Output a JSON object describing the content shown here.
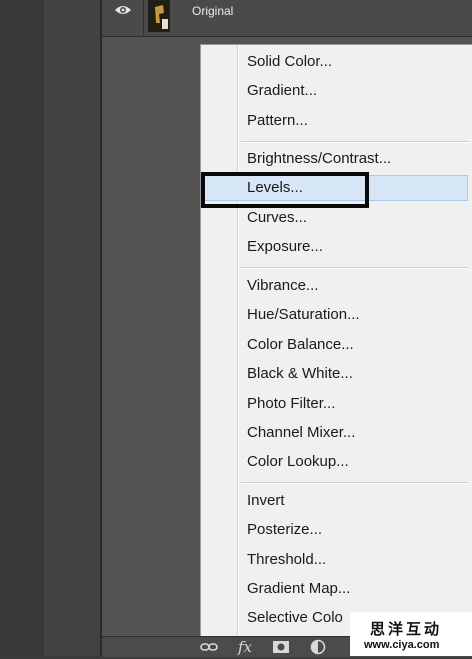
{
  "layer": {
    "name": "Original"
  },
  "menu": {
    "items": [
      {
        "label": "Solid Color...",
        "highlighted": false
      },
      {
        "label": "Gradient...",
        "highlighted": false
      },
      {
        "label": "Pattern...",
        "highlighted": false
      },
      {
        "label": "Brightness/Contrast...",
        "highlighted": false
      },
      {
        "label": "Levels...",
        "highlighted": true
      },
      {
        "label": "Curves...",
        "highlighted": false
      },
      {
        "label": "Exposure...",
        "highlighted": false
      },
      {
        "label": "Vibrance...",
        "highlighted": false
      },
      {
        "label": "Hue/Saturation...",
        "highlighted": false
      },
      {
        "label": "Color Balance...",
        "highlighted": false
      },
      {
        "label": "Black & White...",
        "highlighted": false
      },
      {
        "label": "Photo Filter...",
        "highlighted": false
      },
      {
        "label": "Channel Mixer...",
        "highlighted": false
      },
      {
        "label": "Color Lookup...",
        "highlighted": false
      },
      {
        "label": "Invert",
        "highlighted": false
      },
      {
        "label": "Posterize...",
        "highlighted": false
      },
      {
        "label": "Threshold...",
        "highlighted": false
      },
      {
        "label": "Gradient Map...",
        "highlighted": false
      },
      {
        "label": "Selective Colo",
        "highlighted": false
      }
    ]
  },
  "bottom_bar": {
    "icons": [
      "link-icon",
      "fx-icon",
      "mask-icon",
      "adjustment-layer-icon"
    ],
    "fx_label": "fx"
  },
  "watermark": {
    "chinese": "思洋互动",
    "url": "www.ciya.com"
  },
  "colors": {
    "menu_bg": "#f0f0f0",
    "highlight_bg": "#d6e6f7",
    "panel_bg": "#535353"
  }
}
